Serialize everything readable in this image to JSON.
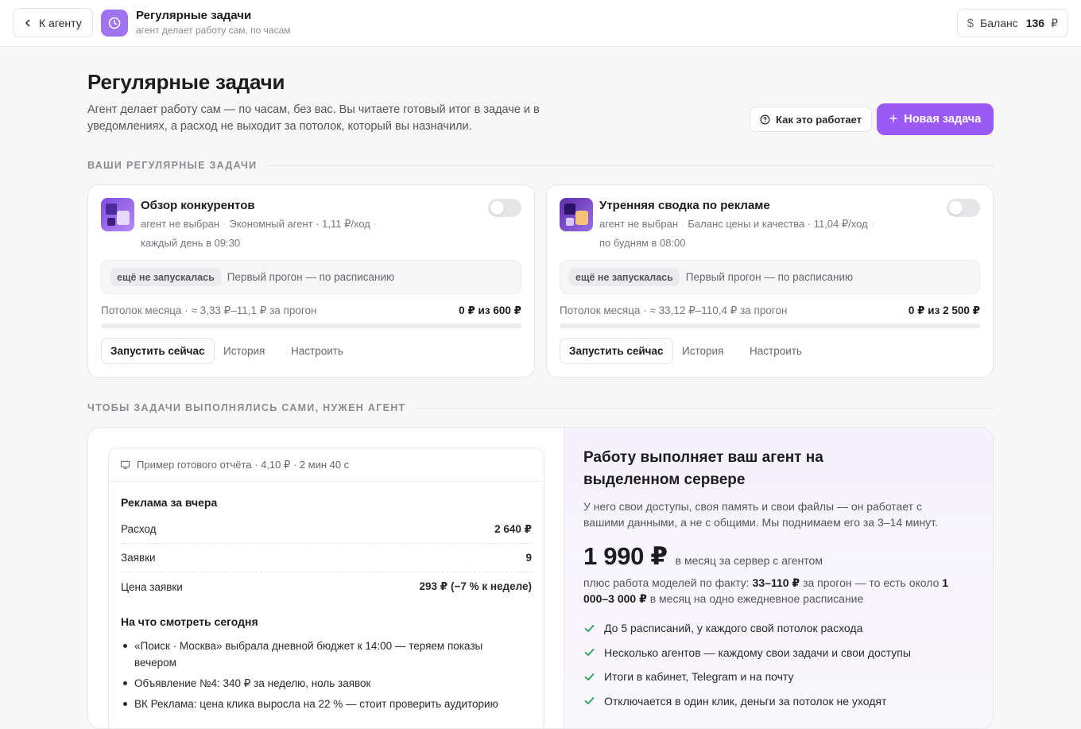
{
  "topbar": {
    "back_label": "К агенту",
    "app_title": "Регулярные задачи",
    "app_subtitle": "агент делает работу сам, по часам",
    "balance_label": "Баланс",
    "balance_amount": "136",
    "balance_currency": "₽",
    "balance_symbol": "$"
  },
  "hero": {
    "title": "Регулярные задачи",
    "description": "Агент делает работу сам — по часам, без вас. Вы читаете готовый итог в задаче и в уведомлениях, а расход не выходит за потолок, который вы назначили.",
    "how_label": "Как это работает",
    "new_label": "Новая задача",
    "new_icon": "+"
  },
  "sections": {
    "tasks": "ВАШИ РЕГУЛЯРНЫЕ ЗАДАЧИ",
    "agent": "ЧТОБЫ ЗАДАЧИ ВЫПОЛНЯЛИСЬ САМИ, НУЖЕН АГЕНТ"
  },
  "tasks": [
    {
      "name": "Обзор конкурентов",
      "agent": "агент не выбран",
      "mode": "Экономный агент · 1,11 ₽/ход",
      "schedule": "каждый день в 09:30",
      "enabled": false,
      "status_badge": "ещё не запускалась",
      "status_text": "Первый прогон — по расписанию",
      "limit_label": "Потолок месяца · ≈ 3,33 ₽–11,1 ₽ за прогон",
      "limit_value": "0 ₽ из 600 ₽",
      "limit_fraction": 0,
      "run_label": "Запустить сейчас",
      "history_label": "История",
      "settings_label": "Настроить"
    },
    {
      "name": "Утренняя сводка по рекламе",
      "agent": "агент не выбран",
      "mode": "Баланс цены и качества · 11,04 ₽/ход",
      "schedule": "по будням в 08:00",
      "enabled": false,
      "status_badge": "ещё не запускалась",
      "status_text": "Первый прогон — по расписанию",
      "limit_label": "Потолок месяца · ≈ 33,12 ₽–110,4 ₽ за прогон",
      "limit_value": "0 ₽ из 2 500 ₽",
      "limit_fraction": 0,
      "run_label": "Запустить сейчас",
      "history_label": "История",
      "settings_label": "Настроить"
    }
  ],
  "report": {
    "header": "Пример готового отчёта · 4,10 ₽ · 2 мин 40 с",
    "title": "Реклама за вчера",
    "rows": [
      {
        "label": "Расход",
        "value": "2 640 ₽"
      },
      {
        "label": "Заявки",
        "value": "9"
      },
      {
        "label": "Цена заявки",
        "value": "293 ₽ (−7 % к неделе)"
      }
    ],
    "subtitle": "На что смотреть сегодня",
    "bullets": [
      "«Поиск · Москва» выбрала дневной бюджет к 14:00 — теряем показы вечером",
      "Объявление №4: 340 ₽ за неделю, ноль заявок",
      "ВК Реклама: цена клика выросла на 22 % — стоит проверить аудиторию"
    ]
  },
  "promo": {
    "title": "Работу выполняет ваш агент на выделенном сервере",
    "description": "У него свои доступы, своя память и свои файлы — он работает с вашими данными, а не с общими. Мы поднимаем его за 3–14 минут.",
    "price": "1 990 ₽",
    "price_period": "в месяц за сервер с агентом",
    "note_prefix": "плюс работа моделей по факту:",
    "note_range": "33–110 ₽",
    "note_middle": "за прогон — то есть около",
    "note_total": "1 000–3 000 ₽",
    "note_suffix": "в месяц на одно ежедневное расписание",
    "features": [
      "До 5 расписаний, у каждого свой потолок расхода",
      "Несколько агентов — каждому свои задачи и свои доступы",
      "Итоги в кабинет, Telegram и на почту",
      "Отключается в один клик, деньги за потолок не уходят"
    ]
  },
  "colors": {
    "accent": "#9b59f5",
    "check": "#2e9b5c"
  }
}
